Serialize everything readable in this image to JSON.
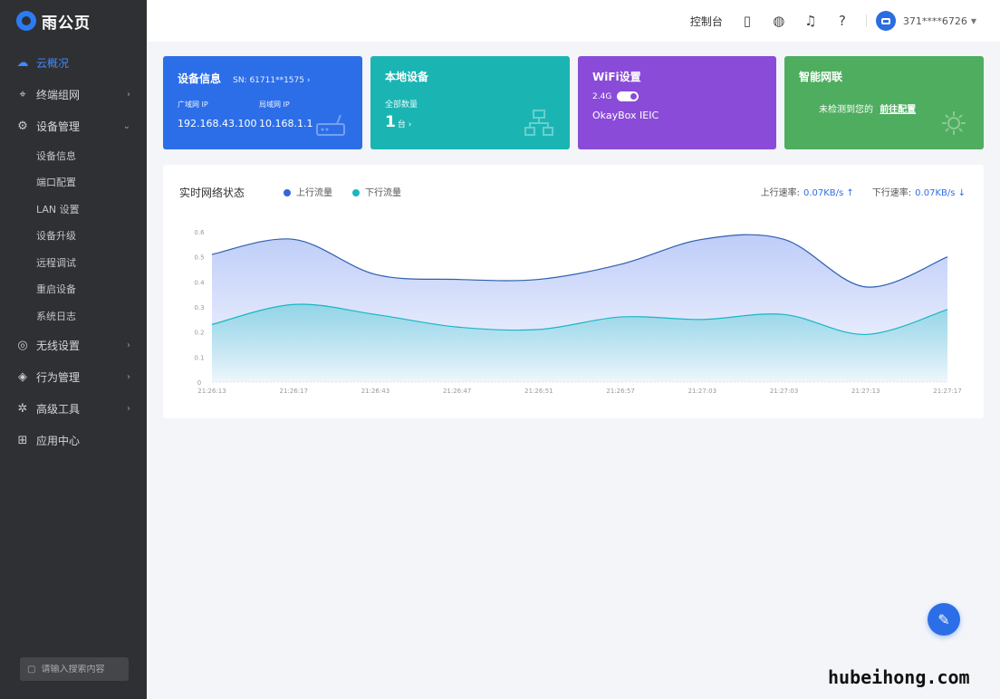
{
  "app": {
    "logo_text": "雨公页"
  },
  "sidebar": {
    "items": [
      {
        "label": "云概况",
        "icon": "cloud-icon",
        "active": true,
        "chevron": ""
      },
      {
        "label": "终端组网",
        "icon": "network-icon",
        "active": false,
        "chevron": "›"
      },
      {
        "label": "设备管理",
        "icon": "settings-icon",
        "active": false,
        "chevron": "⌄"
      }
    ],
    "sub_items": [
      "设备信息",
      "端口配置",
      "LAN 设置",
      "设备升级",
      "远程调试",
      "重启设备",
      "系统日志"
    ],
    "items2": [
      {
        "label": "无线设置",
        "icon": "wifi-icon",
        "chevron": "›"
      },
      {
        "label": "行为管理",
        "icon": "behavior-icon",
        "chevron": "›"
      },
      {
        "label": "高级工具",
        "icon": "tool-icon",
        "chevron": "›"
      },
      {
        "label": "应用中心",
        "icon": "apps-icon",
        "chevron": ""
      }
    ],
    "search_placeholder": "请输入搜索内容"
  },
  "topbar": {
    "text": "控制台",
    "icons": [
      "phone-icon",
      "theme-icon",
      "bell-icon",
      "help-icon"
    ],
    "user": "371****6726"
  },
  "cards": {
    "device": {
      "title": "设备信息",
      "sn": "SN: 61711**1575 ›",
      "wan_label": "广域网 IP",
      "lan_label": "局域网 IP",
      "wan_ip": "192.168.43.100",
      "lan_ip": "10.168.1.1"
    },
    "local": {
      "title": "本地设备",
      "sub": "全部数量",
      "count": "1",
      "unit": "台 ›"
    },
    "wifi": {
      "title": "WiFi设置",
      "band": "2.4G",
      "ssid": "OkayBox IEIC"
    },
    "smart": {
      "title": "智能网联",
      "msg": "未检测到您的",
      "link": "前往配置"
    }
  },
  "chart_panel": {
    "title": "实时网络状态",
    "legend": [
      {
        "name": "上行流量",
        "color": "#3566d8"
      },
      {
        "name": "下行流量",
        "color": "#19b6c4"
      }
    ],
    "rate_up_label": "上行速率:",
    "rate_up": "0.07KB/s ↑",
    "rate_down_label": "下行速率:",
    "rate_down": "0.07KB/s ↓"
  },
  "chart_data": {
    "type": "area",
    "x": [
      "21:26:13",
      "21:26:17",
      "21:26:43",
      "21:26:47",
      "21:26:51",
      "21:26:57",
      "21:27:03",
      "21:27:03",
      "21:27:13",
      "21:27:17"
    ],
    "y_ticks": [
      "0.6",
      "0.5",
      "0.4",
      "0.3",
      "0.2",
      "0.1",
      "0"
    ],
    "ylim": [
      0,
      0.6
    ],
    "series": [
      {
        "name": "上行流量",
        "color": "#3566d8",
        "values": [
          0.51,
          0.57,
          0.43,
          0.41,
          0.41,
          0.47,
          0.57,
          0.57,
          0.38,
          0.5
        ]
      },
      {
        "name": "下行流量",
        "color": "#19b6c4",
        "values": [
          0.23,
          0.31,
          0.27,
          0.22,
          0.21,
          0.26,
          0.25,
          0.27,
          0.19,
          0.29
        ]
      }
    ]
  },
  "watermark": "hubeihong.com"
}
